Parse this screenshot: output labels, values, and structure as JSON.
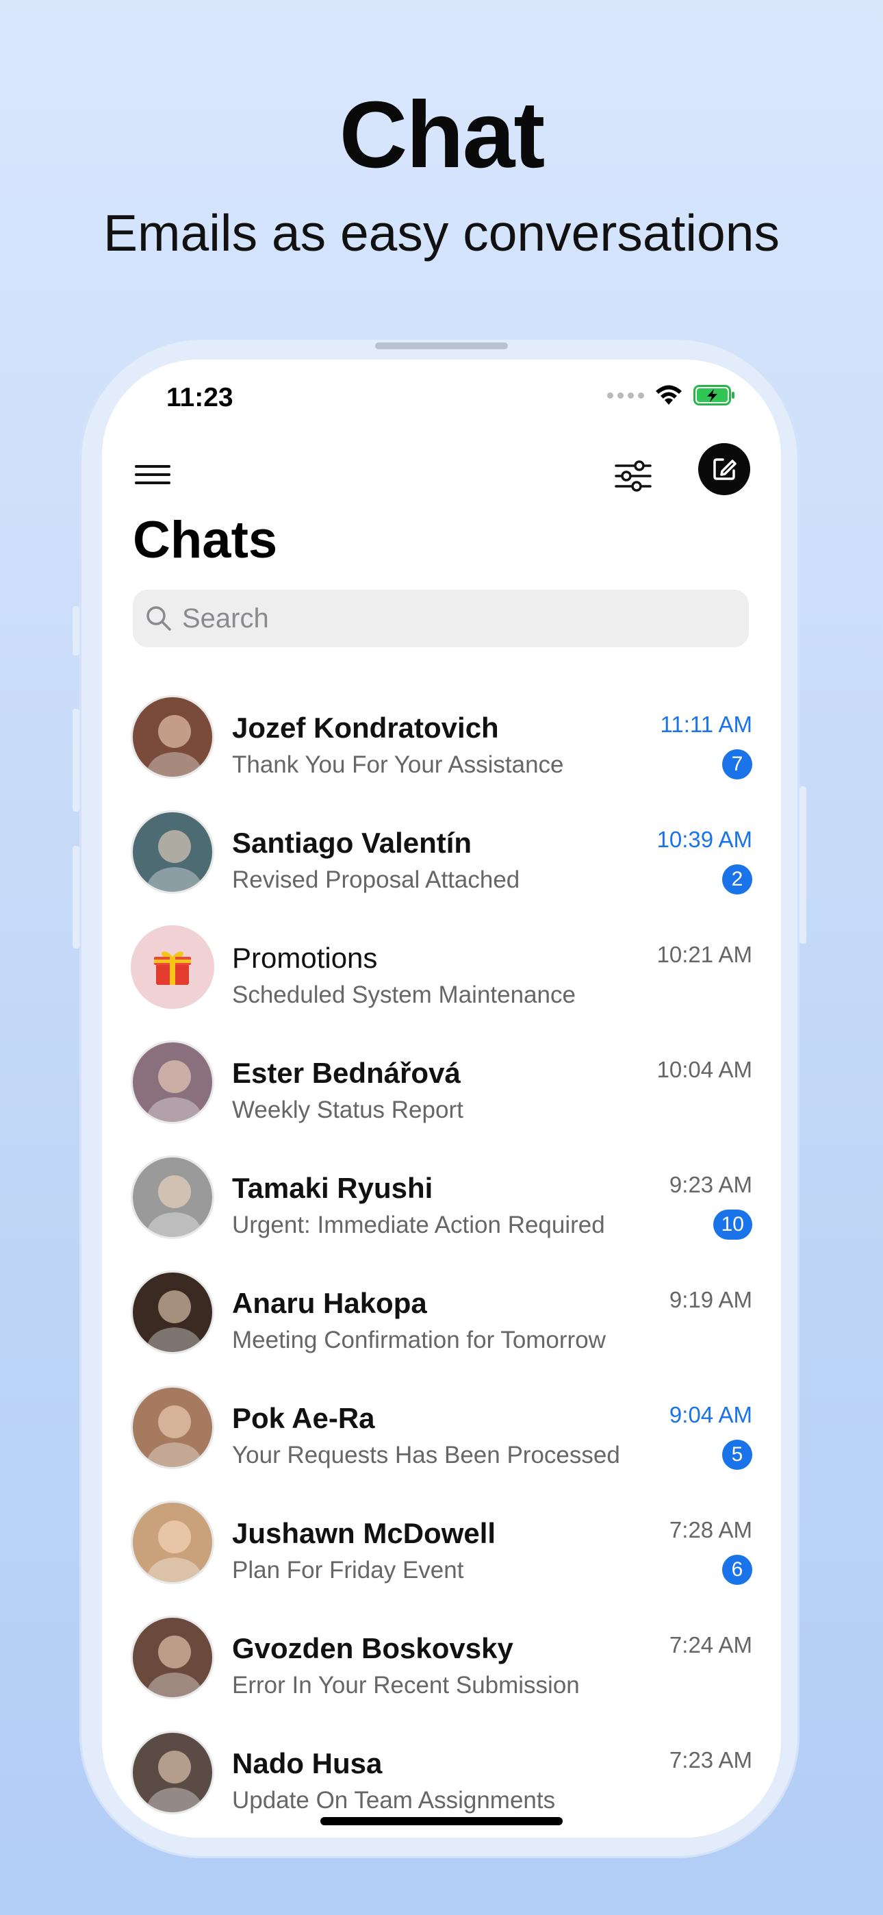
{
  "hero": {
    "title": "Chat",
    "subtitle": "Emails as easy conversations"
  },
  "status_bar": {
    "time": "11:23",
    "icons": [
      "signal-dots",
      "wifi-icon",
      "battery-charging-icon"
    ]
  },
  "toolbar": {
    "menu_icon": "hamburger-menu-icon",
    "filter_icon": "sliders-icon",
    "compose_icon": "compose-icon"
  },
  "page": {
    "title": "Chats"
  },
  "search": {
    "placeholder": "Search",
    "icon": "search-icon"
  },
  "chats": [
    {
      "name": "Jozef Kondratovich",
      "preview": "Thank You For Your Assistance",
      "time": "11:11 AM",
      "unread": true,
      "badge": "7",
      "avatar_color": "#7a4a3a"
    },
    {
      "name": "Santiago Valentín",
      "preview": "Revised Proposal Attached",
      "time": "10:39 AM",
      "unread": true,
      "badge": "2",
      "avatar_color": "#4d6b73"
    },
    {
      "name": "Promotions",
      "preview": "Scheduled System Maintenance",
      "time": "10:21 AM",
      "unread": false,
      "badge": "",
      "avatar_color": "#f0d2d4",
      "is_promo": true
    },
    {
      "name": "Ester Bednářová",
      "preview": "Weekly Status Report",
      "time": "10:04 AM",
      "unread": false,
      "badge": "",
      "avatar_color": "#8a6f7d"
    },
    {
      "name": "Tamaki Ryushi",
      "preview": "Urgent: Immediate Action Required",
      "time": "9:23 AM",
      "unread": false,
      "badge": "10",
      "avatar_color": "#9a9a9a"
    },
    {
      "name": "Anaru Hakopa",
      "preview": "Meeting Confirmation for Tomorrow",
      "time": "9:19 AM",
      "unread": false,
      "badge": "",
      "avatar_color": "#3a2a22"
    },
    {
      "name": "Pok Ae-Ra",
      "preview": "Your Requests Has Been Processed",
      "time": "9:04 AM",
      "unread": true,
      "badge": "5",
      "avatar_color": "#a57a5e"
    },
    {
      "name": "Jushawn McDowell",
      "preview": "Plan For Friday Event",
      "time": "7:28 AM",
      "unread": false,
      "badge": "6",
      "avatar_color": "#c9a27c"
    },
    {
      "name": "Gvozden Boskovsky",
      "preview": "Error In Your Recent Submission",
      "time": "7:24 AM",
      "unread": false,
      "badge": "",
      "avatar_color": "#6b4a3e"
    },
    {
      "name": "Nado Husa",
      "preview": "Update On Team Assignments",
      "time": "7:23 AM",
      "unread": false,
      "badge": "",
      "avatar_color": "#5a4b45"
    }
  ],
  "colors": {
    "accent": "#1a73e8",
    "background_top": "#d9e7fd",
    "background_bottom": "#b2cdf6"
  }
}
